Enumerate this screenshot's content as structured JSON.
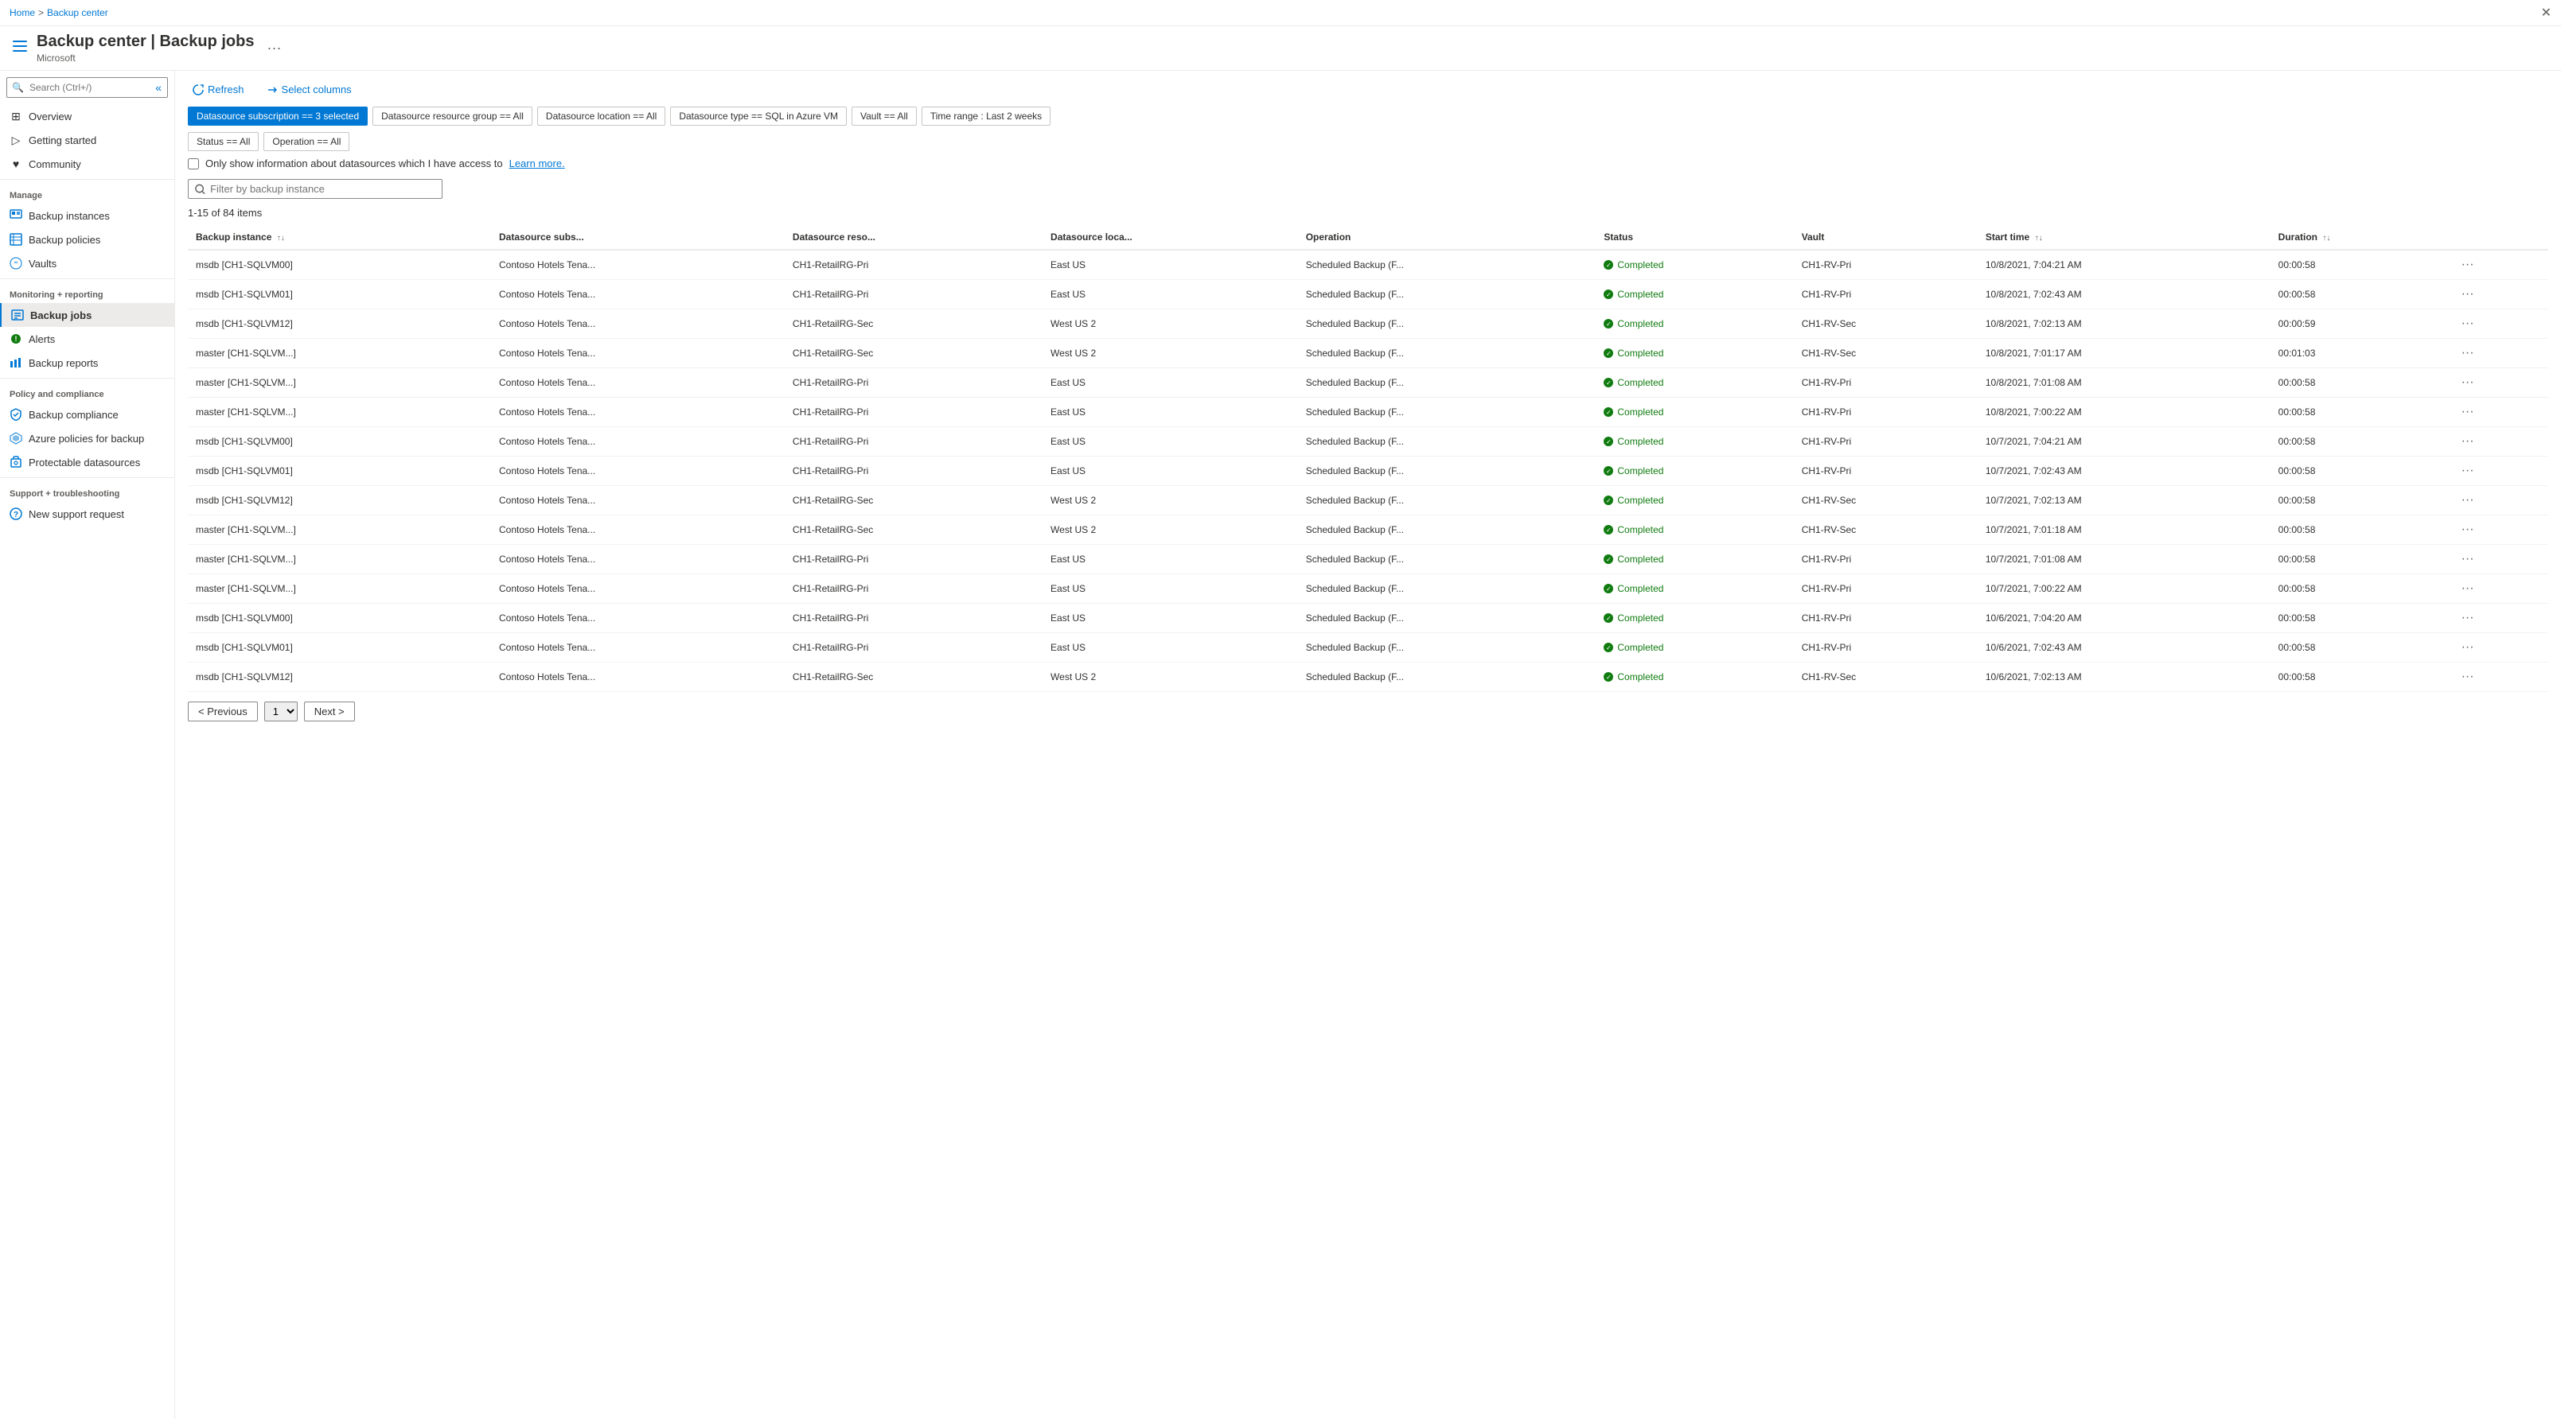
{
  "breadcrumb": {
    "home": "Home",
    "separator": ">",
    "current": "Backup center"
  },
  "header": {
    "title": "Backup center | Backup jobs",
    "subtitle": "Microsoft",
    "more_label": "···"
  },
  "sidebar": {
    "search_placeholder": "Search (Ctrl+/)",
    "collapse_title": "«",
    "items": [
      {
        "id": "overview",
        "label": "Overview",
        "icon": "⊞",
        "section": null
      },
      {
        "id": "getting-started",
        "label": "Getting started",
        "icon": "▷",
        "section": null
      },
      {
        "id": "community",
        "label": "Community",
        "icon": "♥",
        "section": null
      },
      {
        "id": "manage",
        "label": "Manage",
        "section_header": true
      },
      {
        "id": "backup-instances",
        "label": "Backup instances",
        "icon": "☰",
        "section": "Manage"
      },
      {
        "id": "backup-policies",
        "label": "Backup policies",
        "icon": "▦",
        "section": "Manage"
      },
      {
        "id": "vaults",
        "label": "Vaults",
        "icon": "☁",
        "section": "Manage"
      },
      {
        "id": "monitoring",
        "label": "Monitoring + reporting",
        "section_header": true
      },
      {
        "id": "backup-jobs",
        "label": "Backup jobs",
        "icon": "☰",
        "section": "Monitoring",
        "active": true
      },
      {
        "id": "alerts",
        "label": "Alerts",
        "icon": "🔔",
        "section": "Monitoring"
      },
      {
        "id": "backup-reports",
        "label": "Backup reports",
        "icon": "📊",
        "section": "Monitoring"
      },
      {
        "id": "policy-compliance",
        "label": "Policy and compliance",
        "section_header": true
      },
      {
        "id": "backup-compliance",
        "label": "Backup compliance",
        "icon": "✔",
        "section": "Policy"
      },
      {
        "id": "azure-policies",
        "label": "Azure policies for backup",
        "icon": "🔷",
        "section": "Policy"
      },
      {
        "id": "protectable-datasources",
        "label": "Protectable datasources",
        "icon": "🗄",
        "section": "Policy"
      },
      {
        "id": "support",
        "label": "Support + troubleshooting",
        "section_header": true
      },
      {
        "id": "new-support-request",
        "label": "New support request",
        "icon": "❓",
        "section": "Support"
      }
    ]
  },
  "toolbar": {
    "refresh_label": "Refresh",
    "select_columns_label": "Select columns"
  },
  "filters": {
    "datasource_subscription": "Datasource subscription == 3 selected",
    "datasource_resource_group": "Datasource resource group == All",
    "datasource_location": "Datasource location == All",
    "datasource_type": "Datasource type == SQL in Azure VM",
    "vault": "Vault == All",
    "time_range": "Time range : Last 2 weeks",
    "status": "Status == All",
    "operation": "Operation == All"
  },
  "checkbox": {
    "label": "Only show information about datasources which I have access to",
    "learn_more": "Learn more."
  },
  "filter_input": {
    "placeholder": "Filter by backup instance"
  },
  "items_count": "1-15 of 84 items",
  "table": {
    "columns": [
      {
        "id": "backup-instance",
        "label": "Backup instance",
        "sortable": true
      },
      {
        "id": "datasource-subs",
        "label": "Datasource subs...",
        "sortable": false
      },
      {
        "id": "datasource-reso",
        "label": "Datasource reso...",
        "sortable": false
      },
      {
        "id": "datasource-loca",
        "label": "Datasource loca...",
        "sortable": false
      },
      {
        "id": "operation",
        "label": "Operation",
        "sortable": false
      },
      {
        "id": "status",
        "label": "Status",
        "sortable": false
      },
      {
        "id": "vault",
        "label": "Vault",
        "sortable": false
      },
      {
        "id": "start-time",
        "label": "Start time",
        "sortable": true
      },
      {
        "id": "duration",
        "label": "Duration",
        "sortable": true
      },
      {
        "id": "actions",
        "label": "",
        "sortable": false
      }
    ],
    "rows": [
      {
        "backup_instance": "msdb [CH1-SQLVM00]",
        "datasource_subs": "Contoso Hotels Tena...",
        "datasource_reso": "CH1-RetailRG-Pri",
        "datasource_loca": "East US",
        "operation": "Scheduled Backup (F...",
        "status": "Completed",
        "vault": "CH1-RV-Pri",
        "start_time": "10/8/2021, 7:04:21 AM",
        "duration": "00:00:58"
      },
      {
        "backup_instance": "msdb [CH1-SQLVM01]",
        "datasource_subs": "Contoso Hotels Tena...",
        "datasource_reso": "CH1-RetailRG-Pri",
        "datasource_loca": "East US",
        "operation": "Scheduled Backup (F...",
        "status": "Completed",
        "vault": "CH1-RV-Pri",
        "start_time": "10/8/2021, 7:02:43 AM",
        "duration": "00:00:58"
      },
      {
        "backup_instance": "msdb [CH1-SQLVM12]",
        "datasource_subs": "Contoso Hotels Tena...",
        "datasource_reso": "CH1-RetailRG-Sec",
        "datasource_loca": "West US 2",
        "operation": "Scheduled Backup (F...",
        "status": "Completed",
        "vault": "CH1-RV-Sec",
        "start_time": "10/8/2021, 7:02:13 AM",
        "duration": "00:00:59"
      },
      {
        "backup_instance": "master [CH1-SQLVM...]",
        "datasource_subs": "Contoso Hotels Tena...",
        "datasource_reso": "CH1-RetailRG-Sec",
        "datasource_loca": "West US 2",
        "operation": "Scheduled Backup (F...",
        "status": "Completed",
        "vault": "CH1-RV-Sec",
        "start_time": "10/8/2021, 7:01:17 AM",
        "duration": "00:01:03"
      },
      {
        "backup_instance": "master [CH1-SQLVM...]",
        "datasource_subs": "Contoso Hotels Tena...",
        "datasource_reso": "CH1-RetailRG-Pri",
        "datasource_loca": "East US",
        "operation": "Scheduled Backup (F...",
        "status": "Completed",
        "vault": "CH1-RV-Pri",
        "start_time": "10/8/2021, 7:01:08 AM",
        "duration": "00:00:58"
      },
      {
        "backup_instance": "master [CH1-SQLVM...]",
        "datasource_subs": "Contoso Hotels Tena...",
        "datasource_reso": "CH1-RetailRG-Pri",
        "datasource_loca": "East US",
        "operation": "Scheduled Backup (F...",
        "status": "Completed",
        "vault": "CH1-RV-Pri",
        "start_time": "10/8/2021, 7:00:22 AM",
        "duration": "00:00:58"
      },
      {
        "backup_instance": "msdb [CH1-SQLVM00]",
        "datasource_subs": "Contoso Hotels Tena...",
        "datasource_reso": "CH1-RetailRG-Pri",
        "datasource_loca": "East US",
        "operation": "Scheduled Backup (F...",
        "status": "Completed",
        "vault": "CH1-RV-Pri",
        "start_time": "10/7/2021, 7:04:21 AM",
        "duration": "00:00:58"
      },
      {
        "backup_instance": "msdb [CH1-SQLVM01]",
        "datasource_subs": "Contoso Hotels Tena...",
        "datasource_reso": "CH1-RetailRG-Pri",
        "datasource_loca": "East US",
        "operation": "Scheduled Backup (F...",
        "status": "Completed",
        "vault": "CH1-RV-Pri",
        "start_time": "10/7/2021, 7:02:43 AM",
        "duration": "00:00:58"
      },
      {
        "backup_instance": "msdb [CH1-SQLVM12]",
        "datasource_subs": "Contoso Hotels Tena...",
        "datasource_reso": "CH1-RetailRG-Sec",
        "datasource_loca": "West US 2",
        "operation": "Scheduled Backup (F...",
        "status": "Completed",
        "vault": "CH1-RV-Sec",
        "start_time": "10/7/2021, 7:02:13 AM",
        "duration": "00:00:58"
      },
      {
        "backup_instance": "master [CH1-SQLVM...]",
        "datasource_subs": "Contoso Hotels Tena...",
        "datasource_reso": "CH1-RetailRG-Sec",
        "datasource_loca": "West US 2",
        "operation": "Scheduled Backup (F...",
        "status": "Completed",
        "vault": "CH1-RV-Sec",
        "start_time": "10/7/2021, 7:01:18 AM",
        "duration": "00:00:58"
      },
      {
        "backup_instance": "master [CH1-SQLVM...]",
        "datasource_subs": "Contoso Hotels Tena...",
        "datasource_reso": "CH1-RetailRG-Pri",
        "datasource_loca": "East US",
        "operation": "Scheduled Backup (F...",
        "status": "Completed",
        "vault": "CH1-RV-Pri",
        "start_time": "10/7/2021, 7:01:08 AM",
        "duration": "00:00:58"
      },
      {
        "backup_instance": "master [CH1-SQLVM...]",
        "datasource_subs": "Contoso Hotels Tena...",
        "datasource_reso": "CH1-RetailRG-Pri",
        "datasource_loca": "East US",
        "operation": "Scheduled Backup (F...",
        "status": "Completed",
        "vault": "CH1-RV-Pri",
        "start_time": "10/7/2021, 7:00:22 AM",
        "duration": "00:00:58"
      },
      {
        "backup_instance": "msdb [CH1-SQLVM00]",
        "datasource_subs": "Contoso Hotels Tena...",
        "datasource_reso": "CH1-RetailRG-Pri",
        "datasource_loca": "East US",
        "operation": "Scheduled Backup (F...",
        "status": "Completed",
        "vault": "CH1-RV-Pri",
        "start_time": "10/6/2021, 7:04:20 AM",
        "duration": "00:00:58"
      },
      {
        "backup_instance": "msdb [CH1-SQLVM01]",
        "datasource_subs": "Contoso Hotels Tena...",
        "datasource_reso": "CH1-RetailRG-Pri",
        "datasource_loca": "East US",
        "operation": "Scheduled Backup (F...",
        "status": "Completed",
        "vault": "CH1-RV-Pri",
        "start_time": "10/6/2021, 7:02:43 AM",
        "duration": "00:00:58"
      },
      {
        "backup_instance": "msdb [CH1-SQLVM12]",
        "datasource_subs": "Contoso Hotels Tena...",
        "datasource_reso": "CH1-RetailRG-Sec",
        "datasource_loca": "West US 2",
        "operation": "Scheduled Backup (F...",
        "status": "Completed",
        "vault": "CH1-RV-Sec",
        "start_time": "10/6/2021, 7:02:13 AM",
        "duration": "00:00:58"
      }
    ]
  },
  "pagination": {
    "prev_label": "< Previous",
    "next_label": "Next >",
    "current_page": "1"
  }
}
